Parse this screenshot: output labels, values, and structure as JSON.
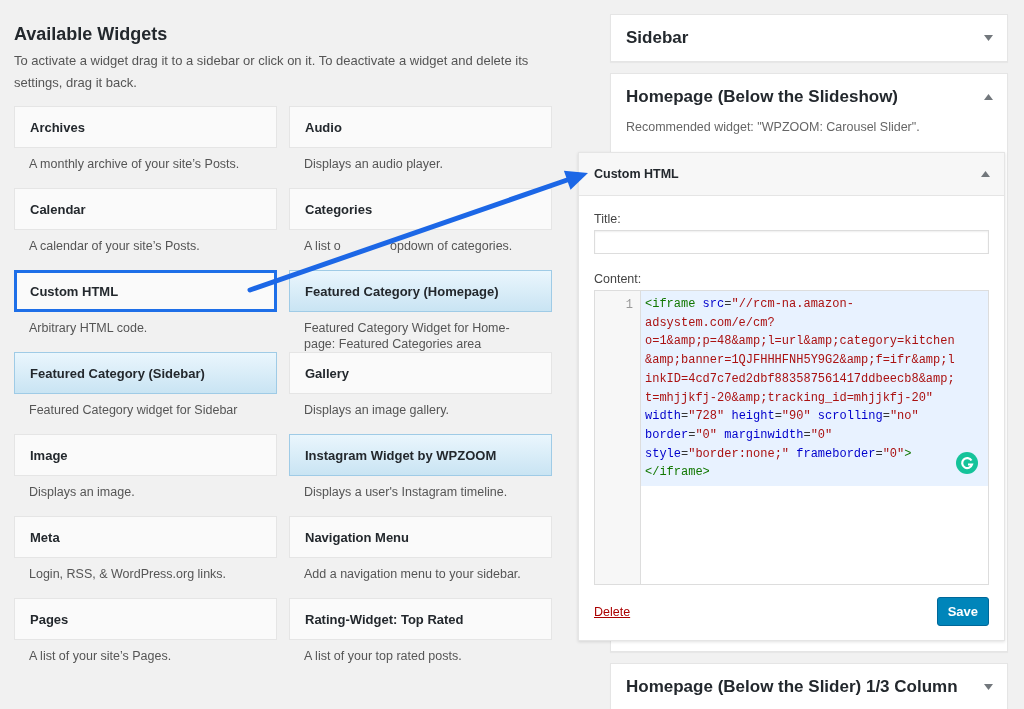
{
  "available_widgets": {
    "title": "Available Widgets",
    "description": "To activate a widget drag it to a sidebar or click on it. To deactivate a widget and delete its settings, drag it back.",
    "widgets": [
      {
        "name": "Archives",
        "description": "A monthly archive of your site’s Posts.",
        "highlighted": false,
        "selected": false
      },
      {
        "name": "Audio",
        "description": "Displays an audio player.",
        "highlighted": false,
        "selected": false
      },
      {
        "name": "Calendar",
        "description": "A calendar of your site’s Posts.",
        "highlighted": false,
        "selected": false
      },
      {
        "name": "Categories",
        "description": "A list o",
        "description_continued": "opdown of categories.",
        "highlighted": false,
        "selected": false
      },
      {
        "name": "Custom HTML",
        "description": "Arbitrary HTML code.",
        "highlighted": false,
        "selected": true
      },
      {
        "name": "Featured Category (Homepage)",
        "description": "Featured Category Widget for Home-page: Featured Categories area",
        "highlighted": true,
        "selected": false
      },
      {
        "name": "Featured Category (Sidebar)",
        "description": "Featured Category widget for Sidebar",
        "highlighted": true,
        "selected": false
      },
      {
        "name": "Gallery",
        "description": "Displays an image gallery.",
        "highlighted": false,
        "selected": false
      },
      {
        "name": "Image",
        "description": "Displays an image.",
        "highlighted": false,
        "selected": false
      },
      {
        "name": "Instagram Widget by WPZOOM",
        "description": "Displays a user's Instagram timeline.",
        "highlighted": true,
        "selected": false
      },
      {
        "name": "Meta",
        "description": "Login, RSS, & WordPress.org links.",
        "highlighted": false,
        "selected": false
      },
      {
        "name": "Navigation Menu",
        "description": "Add a navigation menu to your sidebar.",
        "highlighted": false,
        "selected": false
      },
      {
        "name": "Pages",
        "description": "A list of your site’s Pages.",
        "highlighted": false,
        "selected": false
      },
      {
        "name": "Rating-Widget: Top Rated",
        "description": "A list of your top rated posts.",
        "highlighted": false,
        "selected": false
      }
    ]
  },
  "sidebars": [
    {
      "title": "Sidebar",
      "expanded": false
    },
    {
      "title": "Homepage (Below the Slideshow)",
      "expanded": true,
      "description": "Recommended widget: \"WPZOOM: Carousel Slider\".",
      "widget": {
        "title": "Custom HTML",
        "expanded": true,
        "title_label": "Title:",
        "content_label": "Content:",
        "line_number": "1",
        "code_rows": [
          [
            {
              "kind": "tag",
              "text": "<iframe"
            },
            {
              "kind": "attr",
              "text": " src"
            },
            {
              "kind": "plain",
              "text": "="
            },
            {
              "kind": "string",
              "text": "\"//rcm-na.amazon-"
            }
          ],
          [
            {
              "kind": "string",
              "text": "adsystem.com/e/cm?"
            }
          ],
          [
            {
              "kind": "string",
              "text": "o=1&amp;p=48&amp;l=url&amp;category=kitchen"
            }
          ],
          [
            {
              "kind": "string",
              "text": "&amp;banner=1QJFHHHFNH5Y9G2&amp;f=ifr&amp;l"
            }
          ],
          [
            {
              "kind": "string",
              "text": "inkID=4cd7c7ed2dbf883587561417ddbeecb8&amp;"
            }
          ],
          [
            {
              "kind": "string",
              "text": "t=mhjjkfj-20&amp;tracking_id=mhjjkfj-20\""
            }
          ],
          [
            {
              "kind": "attr",
              "text": "width"
            },
            {
              "kind": "plain",
              "text": "="
            },
            {
              "kind": "string",
              "text": "\"728\""
            },
            {
              "kind": "attr",
              "text": " height"
            },
            {
              "kind": "plain",
              "text": "="
            },
            {
              "kind": "string",
              "text": "\"90\""
            },
            {
              "kind": "attr",
              "text": " scrolling"
            },
            {
              "kind": "plain",
              "text": "="
            },
            {
              "kind": "string",
              "text": "\"no\""
            }
          ],
          [
            {
              "kind": "attr",
              "text": "border"
            },
            {
              "kind": "plain",
              "text": "="
            },
            {
              "kind": "string",
              "text": "\"0\""
            },
            {
              "kind": "attr",
              "text": " marginwidth"
            },
            {
              "kind": "plain",
              "text": "="
            },
            {
              "kind": "string",
              "text": "\"0\""
            }
          ],
          [
            {
              "kind": "attr",
              "text": "style"
            },
            {
              "kind": "plain",
              "text": "="
            },
            {
              "kind": "string",
              "text": "\"border:none;\""
            },
            {
              "kind": "attr",
              "text": " frameborder"
            },
            {
              "kind": "plain",
              "text": "="
            },
            {
              "kind": "string",
              "text": "\"0\""
            },
            {
              "kind": "tag",
              "text": ">"
            }
          ],
          [
            {
              "kind": "tag",
              "text": "</iframe>"
            }
          ]
        ],
        "delete_link": "Delete",
        "save_button": "Save"
      }
    },
    {
      "title": "Homepage (Below the Slider) 1/3 Column",
      "expanded": false
    }
  ]
}
